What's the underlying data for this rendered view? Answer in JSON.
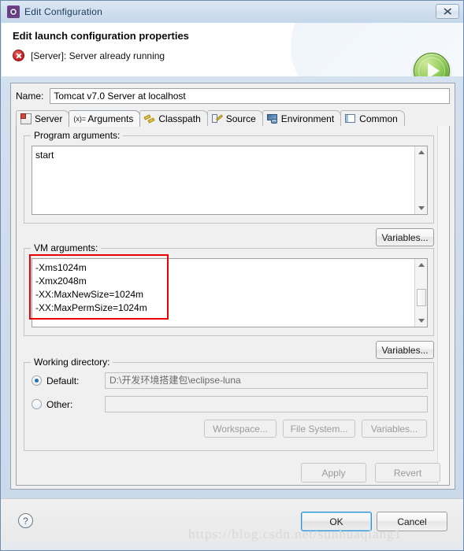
{
  "window": {
    "title": "Edit Configuration",
    "title_icon": "gear-icon",
    "close_label": "✖"
  },
  "header": {
    "title": "Edit launch configuration properties",
    "error_message": "[Server]: Server already running",
    "error_icon": "error-circle-icon",
    "run_icon": "run-play-icon"
  },
  "name_field": {
    "label": "Name:",
    "value": "Tomcat v7.0 Server at localhost",
    "placeholder": ""
  },
  "tabs": [
    {
      "label": "Server",
      "icon": "server-icon",
      "active": false
    },
    {
      "label": "Arguments",
      "icon": "arguments-icon",
      "active": true
    },
    {
      "label": "Classpath",
      "icon": "classpath-icon",
      "active": false
    },
    {
      "label": "Source",
      "icon": "source-icon",
      "active": false
    },
    {
      "label": "Environment",
      "icon": "environment-icon",
      "active": false
    },
    {
      "label": "Common",
      "icon": "common-icon",
      "active": false
    }
  ],
  "tab_icon_args_text": "(x)=",
  "program_arguments": {
    "legend": "Program arguments:",
    "value": "start",
    "variables_button": "Variables..."
  },
  "vm_arguments": {
    "legend": "VM arguments:",
    "value": "-Xms1024m\n-Xmx2048m\n-XX:MaxNewSize=1024m\n-XX:MaxPermSize=1024m",
    "variables_button": "Variables...",
    "highlight_color": "#ee0000"
  },
  "working_directory": {
    "legend": "Working directory:",
    "default_label": "Default:",
    "default_value": "D:\\开发环境搭建包\\eclipse-luna",
    "default_selected": true,
    "other_label": "Other:",
    "other_value": "",
    "other_selected": false,
    "workspace_button": "Workspace...",
    "file_system_button": "File System...",
    "variables_button": "Variables..."
  },
  "panel_actions": {
    "apply": "Apply",
    "revert": "Revert"
  },
  "footer": {
    "help": "?",
    "ok": "OK",
    "cancel": "Cancel"
  },
  "watermark": "https://blog.csdn.net/sunhuaqiang1"
}
